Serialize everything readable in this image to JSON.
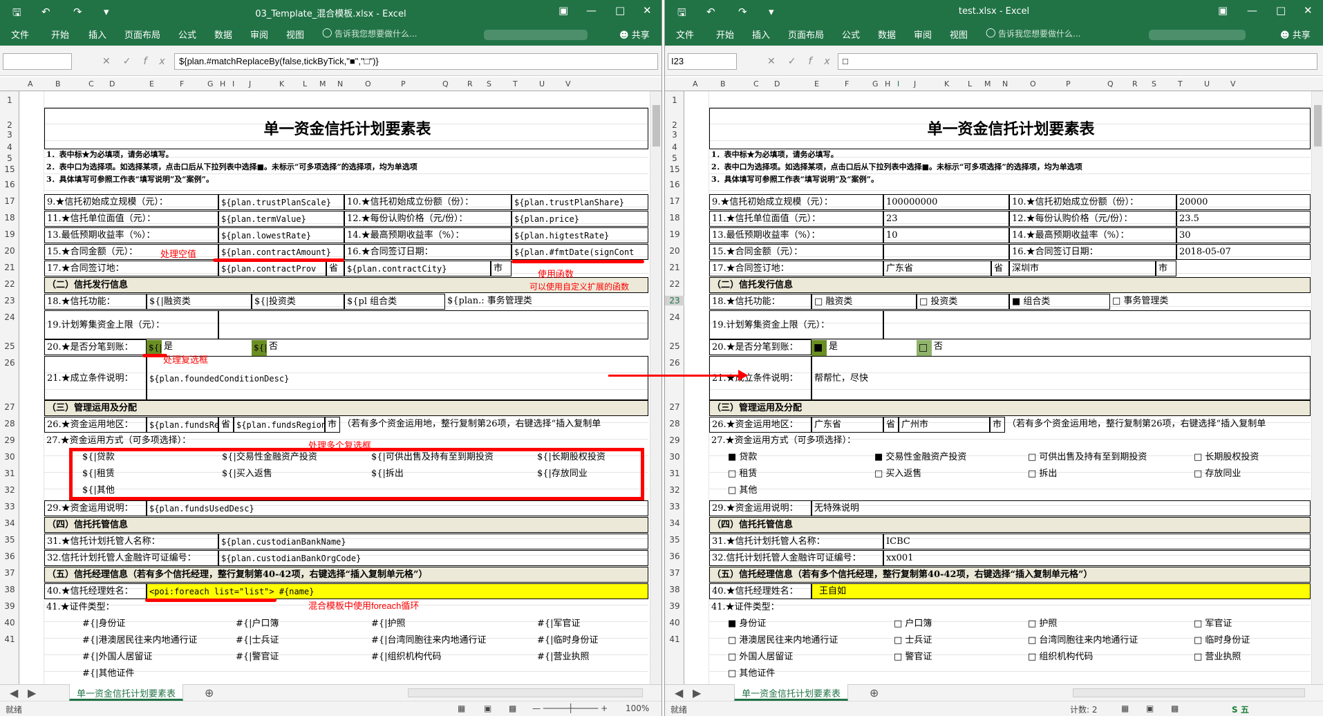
{
  "left": {
    "window_title": "03_Template_混合模板.xlsx - Excel",
    "name_box": "",
    "formula": "${plan.#matchReplaceBy(false,tickByTick,\"■\",\"□\")}",
    "cells": {
      "r2": "单一资金信托计划要素表",
      "r3": "1．表中标★为必填项，请务必填写。",
      "r4": "2．表中口为选择项。如选择某项，点击口后从下拉列表中选择■。未标示“可多项选择”的选择项，均为单选项",
      "r5": "3．具体填写可参照工作表“填写说明”及“案例”。",
      "r15a": "9.★信托初始成立规模（元）：",
      "r15b": "${plan.trustPlanScale}",
      "r15c": "10.★信托初始成立份额（份）：",
      "r15d": "${plan.trustPlanShare}",
      "r16a": "11.★信托单位面值（元）：",
      "r16b": "${plan.termValue}",
      "r16c": "12.★每份认购价格（元/份）：",
      "r16d": "${plan.price}",
      "r17a": "13.最低预期收益率（%）：",
      "r17b": "${plan.lowestRate}",
      "r17c": "14.★最高预期收益率（%）：",
      "r17d": "${plan.higtestRate}",
      "r18a": "15.★合同金额（元）：",
      "r18b": "${plan.contractAmount}",
      "r18c": "16.★合同签订日期：",
      "r18d": "${plan.#fmtDate(signCont",
      "r19a": "17.★合同签订地：",
      "r19b": "${plan.contractProv",
      "r19c": "省",
      "r19d": "${plan.contractCity}",
      "r19e": "市",
      "r20": "（二）信托发行信息",
      "r21a": "18.★信托功能：",
      "r21b": "${|融资类",
      "r21c": "${|投资类",
      "r21d": "${pl 组合类",
      "r21e": "${plan.: 事务管理类",
      "r22a": "19.计划筹集资金上限（元）：",
      "r23a": "20.★是否分笔到账：",
      "r23b": "${|",
      "r23c": "是",
      "r23d": "${|",
      "r23e": "否",
      "r24a": "21.★成立条件说明：",
      "r24b": "${plan.foundedConditionDesc}",
      "r25": "（三）管理运用及分配",
      "r26a": "26.★资金运用地区：",
      "r26b": "${plan.fundsRe",
      "r26c": "省",
      "r26d": "${plan.fundsRegion(",
      "r26e": "市",
      "r26f": "（若有多个资金运用地，整行复制第26项，右键选择“插入复制单",
      "r27a": "27.★资金运用方式（可多项选择）：",
      "r28a": "${|贷款",
      "r28b": "${|交易性金融资产投资",
      "r28c": "${|可供出售及持有至到期投资",
      "r28d": "${|长期股权投资",
      "r29a": "${|租赁",
      "r29b": "${|买入返售",
      "r29c": "${|拆出",
      "r29d": "${|存放同业",
      "r30a": "${|其他",
      "r31a": "29.★资金运用说明：",
      "r31b": "${plan.fundsUsedDesc}",
      "r32": "（四）信托托管信息",
      "r33a": "31.★信托计划托管人名称：",
      "r33b": "${plan.custodianBankName}",
      "r34a": "32.信托计划托管人金融许可证编号：",
      "r34b": "${plan.custodianBankOrgCode}",
      "r35": "（五）信托经理信息（若有多个信托经理，整行复制第40-42项，右键选择“插入复制单元格”）",
      "r36a": "40.★信托经理姓名：",
      "r36b": "<poi:foreach list=\"list\"> #{name}",
      "r37a": "41.★证件类型：",
      "r38a": "#{|身份证",
      "r38b": "#{|户口簿",
      "r38c": "#{|护照",
      "r38d": "#{|军官证",
      "r39a": "#{|港澳居民往来内地通行证",
      "r39b": "#{|士兵证",
      "r39c": "#{|台湾同胞往来内地通行证",
      "r39d": "#{|临时身份证",
      "r40a": "#{|外国人居留证",
      "r40b": "#{|警官证",
      "r40c": "#{|组织机构代码",
      "r40d": "#{|营业执照",
      "r41a": "#{|其他证件"
    },
    "annotations": {
      "empty_value": "处理空值",
      "use_function": "使用函数",
      "custom_function": "可以使用自定义扩展的函数",
      "checkbox": "处理复选框",
      "multi_checkbox": "处理多个复选框",
      "foreach": "混合模板中使用foreach循环"
    },
    "status_ready": "就绪",
    "zoom": "100%"
  },
  "right": {
    "window_title": "test.xlsx - Excel",
    "name_box": "I23",
    "formula": "□",
    "cells": {
      "r2": "单一资金信托计划要素表",
      "r3": "1．表中标★为必填项，请务必填写。",
      "r4": "2．表中口为选择项。如选择某项，点击口后从下拉列表中选择■。未标示“可多项选择”的选择项，均为单选项",
      "r5": "3．具体填写可参照工作表“填写说明”及“案例”。",
      "r15a": "9.★信托初始成立规模（元）：",
      "r15b": "100000000",
      "r15c": "10.★信托初始成立份额（份）：",
      "r15d": "20000",
      "r16a": "11.★信托单位面值（元）：",
      "r16b": "23",
      "r16c": "12.★每份认购价格（元/份）：",
      "r16d": "23.5",
      "r17a": "13.最低预期收益率（%）：",
      "r17b": "10",
      "r17c": "14.★最高预期收益率（%）：",
      "r17d": "30",
      "r18a": "15.★合同金额（元）：",
      "r18b": "",
      "r18c": "16.★合同签订日期：",
      "r18d": "2018-05-07",
      "r19a": "17.★合同签订地：",
      "r19b": "广东省",
      "r19c": "省",
      "r19d": "深圳市",
      "r19e": "市",
      "r20": "（二）信托发行信息",
      "r21a": "18.★信托功能：",
      "r21b": "□ 融资类",
      "r21c": "□ 投资类",
      "r21d": "■    组合类",
      "r21e": "□    事务管理类",
      "r22a": "19.计划筹集资金上限（元）：",
      "r23a": "20.★是否分笔到账：",
      "r23b": "■",
      "r23c": "是",
      "r23d": "□",
      "r23e": "否",
      "r24a": "21.★成立条件说明：",
      "r24b": "帮帮忙，尽快",
      "r25": "（三）管理运用及分配",
      "r26a": "26.★资金运用地区：",
      "r26b": "广东省",
      "r26c": "省",
      "r26d": "广州市",
      "r26e": "市",
      "r26f": "（若有多个资金运用地，整行复制第26项，右键选择“插入复制单",
      "r27a": "27.★资金运用方式（可多项选择）：",
      "r28a": "■   贷款",
      "r28b": "■   交易性金融资产投资",
      "r28c": "□   可供出售及持有至到期投资",
      "r28d": "□   长期股权投资",
      "r29a": "□   租赁",
      "r29b": "□   买入返售",
      "r29c": "□   拆出",
      "r29d": "□   存放同业",
      "r30a": "□   其他",
      "r31a": "29.★资金运用说明：",
      "r31b": "无特殊说明",
      "r32": "（四）信托托管信息",
      "r33a": "31.★信托计划托管人名称：",
      "r33b": "ICBC",
      "r34a": "32.信托计划托管人金融许可证编号：",
      "r34b": "xx001",
      "r35": "（五）信托经理信息（若有多个信托经理，整行复制第40-42项，右键选择“插入复制单元格”）",
      "r36a": "40.★信托经理姓名：",
      "r36b": "王自如",
      "r37a": "41.★证件类型：",
      "r38a": "■   身份证",
      "r38b": "□   户口簿",
      "r38c": "□   护照",
      "r38d": "□   军官证",
      "r39a": "□   港澳居民往来内地通行证",
      "r39b": "□   士兵证",
      "r39c": "□   台湾同胞往来内地通行证",
      "r39d": "□   临时身份证",
      "r40a": "□   外国人居留证",
      "r40b": "□   警官证",
      "r40c": "□   组织机构代码",
      "r40d": "□   营业执照",
      "r41a": "□   其他证件"
    },
    "status_ready": "就绪",
    "count_label": "计数: 2"
  },
  "ribbon_tabs": [
    "文件",
    "开始",
    "插入",
    "页面布局",
    "公式",
    "数据",
    "审阅",
    "视图"
  ],
  "tell_me": "告诉我您想要做什么...",
  "share": "共享",
  "sheet_tab": "单一资金信托计划要素表",
  "columns_left": [
    "A",
    "B",
    "C",
    "D",
    "E",
    "F",
    "G",
    "H",
    "I",
    "J",
    "K",
    "L",
    "M",
    "N",
    "O",
    "P",
    "Q",
    "R",
    "S",
    "T",
    "U",
    "V"
  ],
  "columns_right": [
    "A",
    "B",
    "C",
    "D",
    "E",
    "F",
    "G",
    "H",
    "I",
    "J",
    "K",
    "L",
    "M",
    "N",
    "O",
    "P",
    "Q",
    "R",
    "S",
    "T",
    "U",
    "V"
  ],
  "rows": [
    "1",
    "2",
    "3",
    "4",
    "5",
    "15",
    "16",
    "17",
    "18",
    "19",
    "20",
    "21",
    "22",
    "23",
    "24",
    "25",
    "26",
    "27",
    "28",
    "29",
    "30",
    "31",
    "32",
    "33",
    "34",
    "35",
    "36",
    "37",
    "38",
    "39",
    "40",
    "41"
  ],
  "ime": "五",
  "colors": {
    "excel_green": "#217346",
    "section_bg": "#ece9d8",
    "annotation_red": "#ff0000",
    "yellow": "#ffff00"
  }
}
